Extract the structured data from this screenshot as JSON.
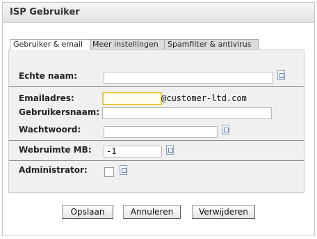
{
  "window": {
    "title": "ISP Gebruiker"
  },
  "tabs": [
    {
      "label": "Gebruiker & email",
      "active": true
    },
    {
      "label": "Meer instellingen",
      "active": false
    },
    {
      "label": "Spamfilter & antivirus",
      "active": false
    }
  ],
  "form": {
    "real_name": {
      "label": "Echte naam:",
      "value": ""
    },
    "email": {
      "label": "Emailadres:",
      "value": "",
      "domain_suffix": "@customer-ltd.com"
    },
    "username": {
      "label": "Gebruikersnaam:",
      "value": ""
    },
    "password": {
      "label": "Wachtwoord:",
      "value": ""
    },
    "webspace": {
      "label": "Webruimte MB:",
      "value": "-1"
    },
    "administrator": {
      "label": "Administrator:",
      "checked": false
    }
  },
  "buttons": {
    "save": "Opslaan",
    "cancel": "Annuleren",
    "delete": "Verwijderen"
  },
  "colors": {
    "focus_border": "#e8c84a",
    "panel_bg": "#f0f0f0",
    "title_bar": "#e8e8e8"
  },
  "icons": {
    "help": "help-document-icon"
  }
}
